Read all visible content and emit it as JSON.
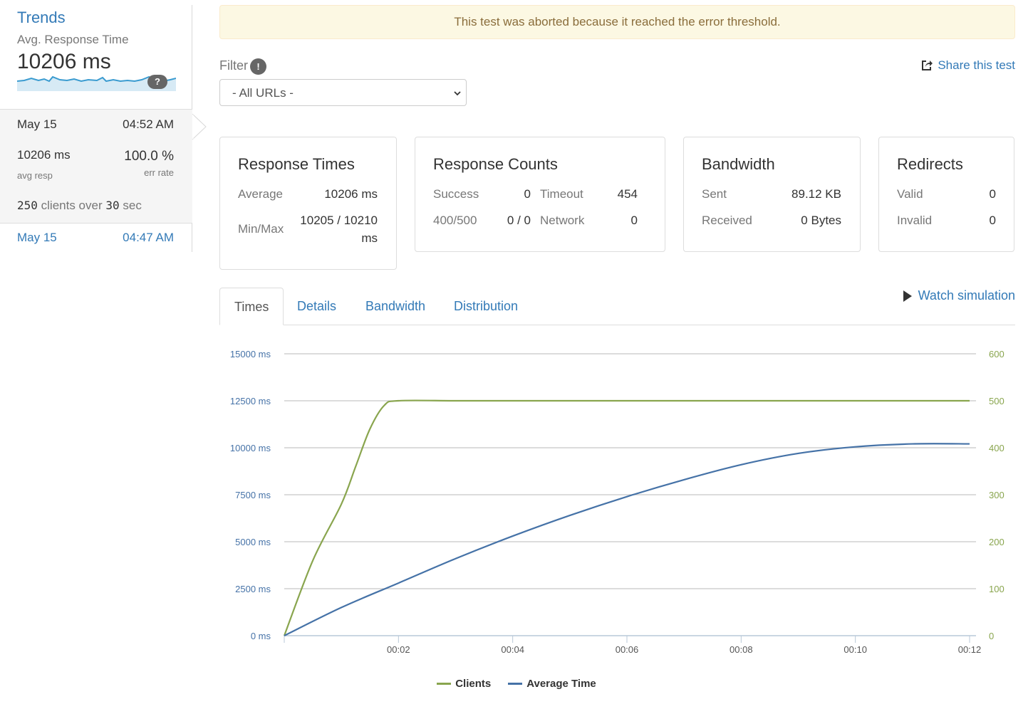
{
  "sidebar": {
    "title": "Trends",
    "avg_label": "Avg. Response Time",
    "avg_value": "10206 ms",
    "help": "?",
    "current_run": {
      "date": "May 15",
      "time": "04:52 AM",
      "avg_resp": "10206 ms",
      "avg_resp_label": "avg resp",
      "err_rate": "100.0 %",
      "err_rate_label": "err rate",
      "clients": "250",
      "clients_text1": "clients over",
      "duration": "30",
      "clients_text2": "sec"
    },
    "previous_run": {
      "date": "May 15",
      "time": "04:47 AM"
    }
  },
  "alert": "This test was aborted because it reached the error threshold.",
  "filter": {
    "label": "Filter",
    "info": "!",
    "selected": "- All URLs -"
  },
  "share_label": "Share this test",
  "cards": {
    "response_times": {
      "title": "Response Times",
      "average_label": "Average",
      "average_value": "10206 ms",
      "minmax_label": "Min/Max",
      "minmax_value_1": "10205 / 10210",
      "minmax_value_2": "ms"
    },
    "response_counts": {
      "title": "Response Counts",
      "success_label": "Success",
      "success_value": "0",
      "timeout_label": "Timeout",
      "timeout_value": "454",
      "http_label": "400/500",
      "http_value": "0 / 0",
      "network_label": "Network",
      "network_value": "0"
    },
    "bandwidth": {
      "title": "Bandwidth",
      "sent_label": "Sent",
      "sent_value": "89.12 KB",
      "received_label": "Received",
      "received_value": "0 Bytes"
    },
    "redirects": {
      "title": "Redirects",
      "valid_label": "Valid",
      "valid_value": "0",
      "invalid_label": "Invalid",
      "invalid_value": "0"
    }
  },
  "tabs": [
    {
      "label": "Times",
      "active": true
    },
    {
      "label": "Details",
      "active": false
    },
    {
      "label": "Bandwidth",
      "active": false
    },
    {
      "label": "Distribution",
      "active": false
    }
  ],
  "watch_label": "Watch simulation",
  "colors": {
    "clients": "#89a54e",
    "avg_time": "#4572a7",
    "link": "#337ab7"
  },
  "chart_data": {
    "type": "line",
    "x_ticks": [
      "00:02",
      "00:04",
      "00:06",
      "00:08",
      "00:10",
      "00:12"
    ],
    "y_left_ticks": [
      "0 ms",
      "2500 ms",
      "5000 ms",
      "7500 ms",
      "10000 ms",
      "12500 ms",
      "15000 ms"
    ],
    "y_left_range": [
      0,
      15000
    ],
    "y_right_ticks": [
      "0",
      "100",
      "200",
      "300",
      "400",
      "500",
      "600"
    ],
    "y_right_range": [
      0,
      600
    ],
    "x_range_seconds": [
      0,
      12
    ],
    "grid": true,
    "legend_position": "bottom-center",
    "series": [
      {
        "name": "Clients",
        "axis": "right",
        "x": [
          0,
          0.5,
          1,
          1.25,
          1.5,
          1.75,
          2,
          3,
          4,
          5,
          6,
          7,
          8,
          9,
          10,
          11,
          12
        ],
        "values": [
          0,
          160,
          280,
          360,
          440,
          490,
          500,
          500,
          500,
          500,
          500,
          500,
          500,
          500,
          500,
          500,
          500
        ]
      },
      {
        "name": "Average Time",
        "axis": "left",
        "x": [
          0,
          1,
          2,
          3,
          4,
          5,
          6,
          7,
          8,
          9,
          10,
          11,
          12
        ],
        "values": [
          0,
          1500,
          2800,
          4100,
          5300,
          6400,
          7400,
          8300,
          9100,
          9700,
          10050,
          10206,
          10206
        ]
      }
    ]
  }
}
